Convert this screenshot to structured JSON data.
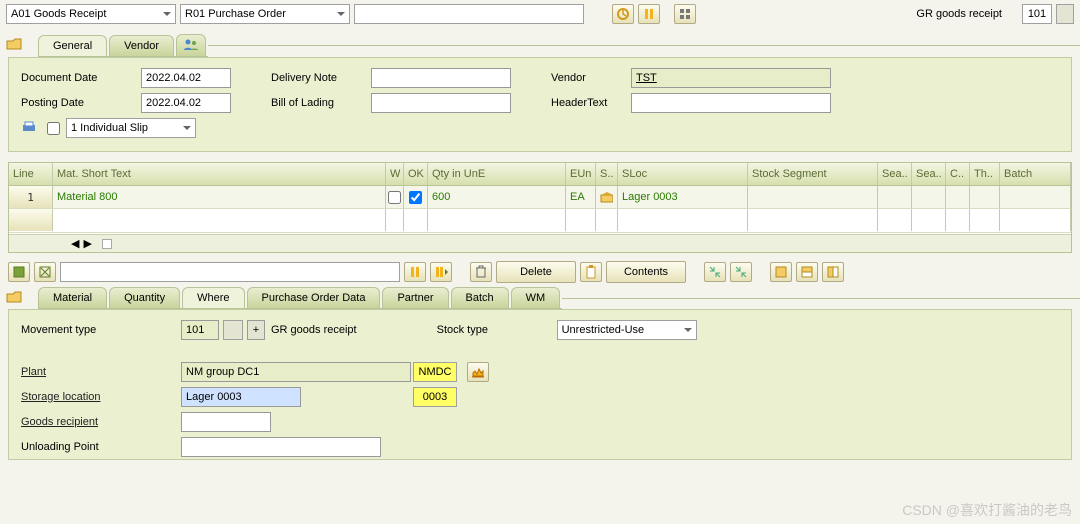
{
  "header": {
    "movement_category": "A01 Goods Receipt",
    "doc_category": "R01 Purchase Order",
    "docnum": "",
    "gr_label": "GR goods receipt",
    "gr_code": "101"
  },
  "tabs_top": {
    "general": "General",
    "vendor": "Vendor"
  },
  "general": {
    "doc_date_lbl": "Document Date",
    "doc_date": "2022.04.02",
    "post_date_lbl": "Posting Date",
    "post_date": "2022.04.02",
    "slip_option": "1 Individual Slip",
    "deliv_note_lbl": "Delivery Note",
    "deliv_note": "",
    "bol_lbl": "Bill of Lading",
    "bol": "",
    "vendor_lbl": "Vendor",
    "vendor": "TST",
    "htext_lbl": "HeaderText",
    "htext": ""
  },
  "grid": {
    "cols": {
      "line": "Line",
      "mat": "Mat. Short Text",
      "w": "W",
      "ok": "OK",
      "qty": "Qty in UnE",
      "eun": "EUn",
      "s": "S..",
      "sloc": "SLoc",
      "sseg": "Stock Segment",
      "sea1": "Sea..",
      "sea2": "Sea..",
      "c": "C..",
      "th": "Th..",
      "batch": "Batch"
    },
    "rows": [
      {
        "line": "1",
        "mat": "Material 800",
        "ok": true,
        "qty": "600",
        "eun": "EA",
        "sloc": "Lager 0003"
      }
    ]
  },
  "toolbar": {
    "delete": "Delete",
    "contents": "Contents"
  },
  "tabs_detail": {
    "material": "Material",
    "quantity": "Quantity",
    "where": "Where",
    "po": "Purchase Order Data",
    "partner": "Partner",
    "batch": "Batch",
    "wm": "WM"
  },
  "where": {
    "mvt_lbl": "Movement type",
    "mvt_code": "101",
    "mvt_text": "GR goods receipt",
    "stock_type_lbl": "Stock type",
    "stock_type": "Unrestricted-Use",
    "plant_lbl": "Plant",
    "plant_text": "NM group DC1",
    "plant_code": "NMDC",
    "sloc_lbl": "Storage location",
    "sloc_text": "Lager 0003",
    "sloc_code": "0003",
    "goods_rcpt_lbl": "Goods recipient",
    "unload_lbl": "Unloading Point"
  },
  "watermark": "CSDN @喜欢打酱油的老鸟"
}
